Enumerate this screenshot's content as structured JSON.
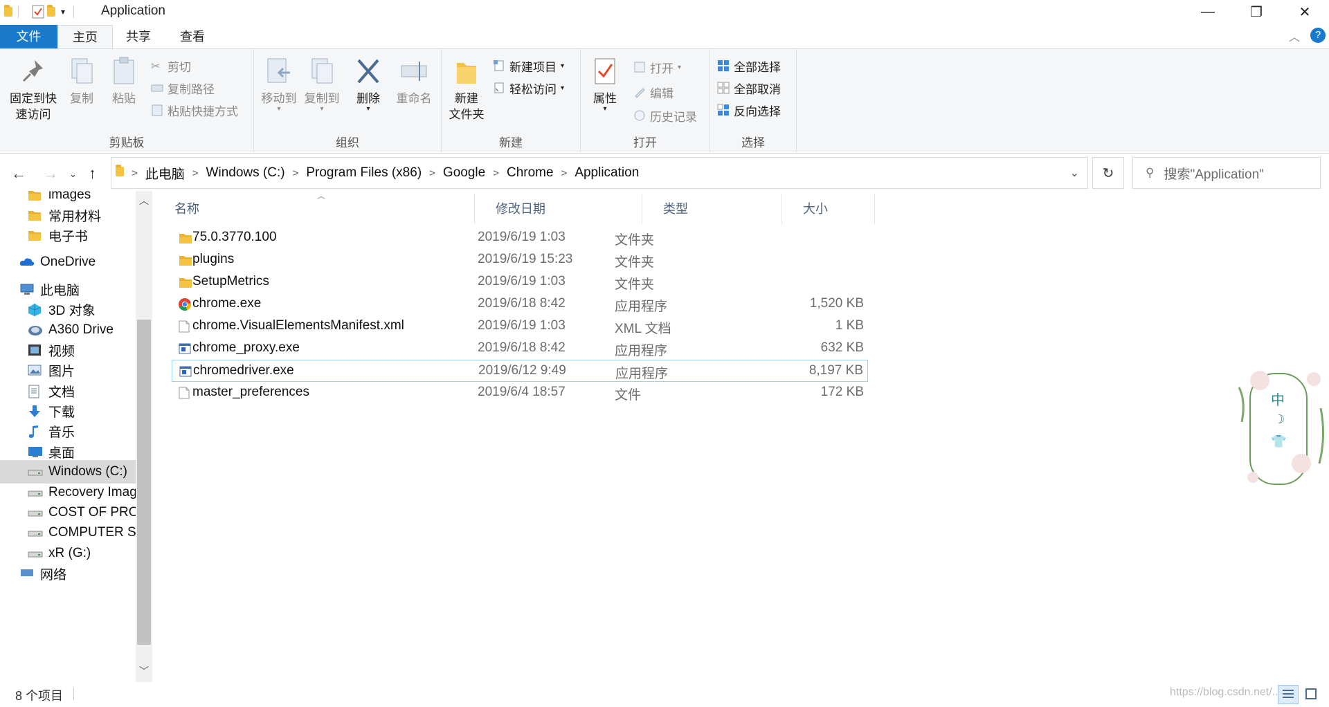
{
  "window": {
    "title": "Application",
    "minimize": "—",
    "maximize": "❐",
    "close": "✕"
  },
  "ribbon_tabs": {
    "file": "文件",
    "home": "主页",
    "share": "共享",
    "view": "查看"
  },
  "ribbon": {
    "clipboard": {
      "label": "剪贴板",
      "pin_line1": "固定到快",
      "pin_line2": "速访问",
      "copy": "复制",
      "paste": "粘贴",
      "cut": "剪切",
      "copy_path": "复制路径",
      "paste_shortcut": "粘贴快捷方式"
    },
    "organize": {
      "label": "组织",
      "move_to": "移动到",
      "copy_to": "复制到",
      "delete": "删除",
      "rename": "重命名"
    },
    "new": {
      "label": "新建",
      "new_folder_line1": "新建",
      "new_folder_line2": "文件夹",
      "new_item": "新建项目",
      "easy_access": "轻松访问"
    },
    "open": {
      "label": "打开",
      "properties": "属性",
      "open": "打开",
      "edit": "编辑",
      "history": "历史记录"
    },
    "select": {
      "label": "选择",
      "select_all": "全部选择",
      "select_none": "全部取消",
      "invert": "反向选择"
    }
  },
  "address": {
    "crumbs": [
      "此电脑",
      "Windows (C:)",
      "Program Files (x86)",
      "Google",
      "Chrome",
      "Application"
    ],
    "search_placeholder": "搜索\"Application\""
  },
  "nav": {
    "items": [
      {
        "label": "images",
        "icon": "folder-icon"
      },
      {
        "label": "常用材料",
        "icon": "folder-icon"
      },
      {
        "label": "电子书",
        "icon": "folder-icon"
      },
      {
        "label": "OneDrive",
        "icon": "onedrive-icon"
      },
      {
        "label": "此电脑",
        "icon": "computer-icon"
      },
      {
        "label": "3D 对象",
        "icon": "3d-objects-icon"
      },
      {
        "label": "A360 Drive",
        "icon": "a360-drive-icon"
      },
      {
        "label": "视频",
        "icon": "video-icon"
      },
      {
        "label": "图片",
        "icon": "pictures-icon"
      },
      {
        "label": "文档",
        "icon": "documents-icon"
      },
      {
        "label": "下载",
        "icon": "download-icon"
      },
      {
        "label": "音乐",
        "icon": "music-icon"
      },
      {
        "label": "桌面",
        "icon": "desktop-icon"
      },
      {
        "label": "Windows (C:)",
        "icon": "drive-icon"
      },
      {
        "label": "Recovery Imag",
        "icon": "drive-icon"
      },
      {
        "label": "COST OF PRO",
        "icon": "drive-icon"
      },
      {
        "label": "COMPUTER S",
        "icon": "drive-icon"
      },
      {
        "label": "xR (G:)",
        "icon": "drive-icon"
      },
      {
        "label": "网络",
        "icon": "network-icon"
      }
    ]
  },
  "columns": {
    "name": "名称",
    "date": "修改日期",
    "type": "类型",
    "size": "大小"
  },
  "files": [
    {
      "name": "75.0.3770.100",
      "date": "2019/6/19 1:03",
      "type": "文件夹",
      "size": "",
      "icon": "folder-icon"
    },
    {
      "name": "plugins",
      "date": "2019/6/19 15:23",
      "type": "文件夹",
      "size": "",
      "icon": "folder-icon"
    },
    {
      "name": "SetupMetrics",
      "date": "2019/6/19 1:03",
      "type": "文件夹",
      "size": "",
      "icon": "folder-icon"
    },
    {
      "name": "chrome.exe",
      "date": "2019/6/18 8:42",
      "type": "应用程序",
      "size": "1,520 KB",
      "icon": "chrome-icon"
    },
    {
      "name": "chrome.VisualElementsManifest.xml",
      "date": "2019/6/19 1:03",
      "type": "XML 文档",
      "size": "1 KB",
      "icon": "file-icon"
    },
    {
      "name": "chrome_proxy.exe",
      "date": "2019/6/18 8:42",
      "type": "应用程序",
      "size": "632 KB",
      "icon": "exe-icon"
    },
    {
      "name": "chromedriver.exe",
      "date": "2019/6/12 9:49",
      "type": "应用程序",
      "size": "8,197 KB",
      "icon": "exe-icon"
    },
    {
      "name": "master_preferences",
      "date": "2019/6/4 18:57",
      "type": "文件",
      "size": "172 KB",
      "icon": "file-icon"
    }
  ],
  "status": {
    "count": "8 个项目",
    "watermark": "https://blog.csdn.net/..."
  },
  "ime": {
    "chars": [
      "中",
      "☽",
      "👕"
    ]
  },
  "colors": {
    "accent": "#1979ca",
    "selection_border": "#99d1ff",
    "folder": "#f5c342"
  }
}
